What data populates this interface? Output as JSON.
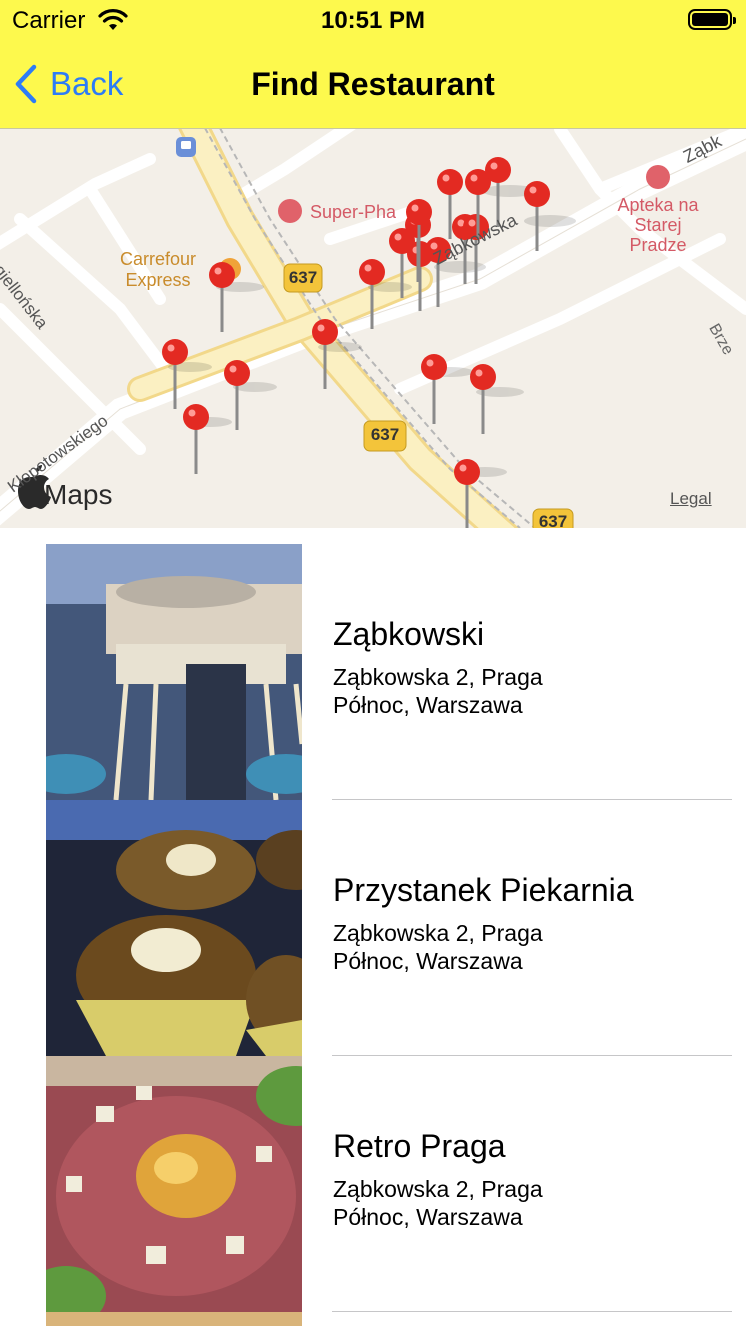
{
  "status_bar": {
    "carrier": "Carrier",
    "time": "10:51 PM"
  },
  "nav": {
    "back_label": "Back",
    "title": "Find Restaurant"
  },
  "map": {
    "attribution": "Maps",
    "legal": "Legal",
    "labels": {
      "street_zabkowska": "Ząbkowska",
      "street_zabk_corner": "Ząbk",
      "street_jagiellonska": "Jagiellońska",
      "street_klopotowskiego": "Kłopotowskiego",
      "street_brze": "Brze",
      "poi_superpharm": "Super-Pha",
      "poi_carrefour_line1": "Carrefour",
      "poi_carrefour_line2": "Express",
      "poi_apteka_line1": "Apteka na",
      "poi_apteka_line2": "Starej",
      "poi_apteka_line3": "Pradze",
      "road_637": "637"
    },
    "pin_count": 20
  },
  "restaurants": [
    {
      "name": "Ząbkowski",
      "address": "Ząbkowska 2, Praga Północ, Warszawa"
    },
    {
      "name": "Przystanek Piekarnia",
      "address": "Ząbkowska 2, Praga Północ, Warszawa"
    },
    {
      "name": "Retro Praga",
      "address": "Ząbkowska 2, Praga Północ, Warszawa"
    }
  ],
  "colors": {
    "nav_background": "#fdf94d",
    "tint": "#2d7cf6",
    "pin": "#e32a22"
  }
}
